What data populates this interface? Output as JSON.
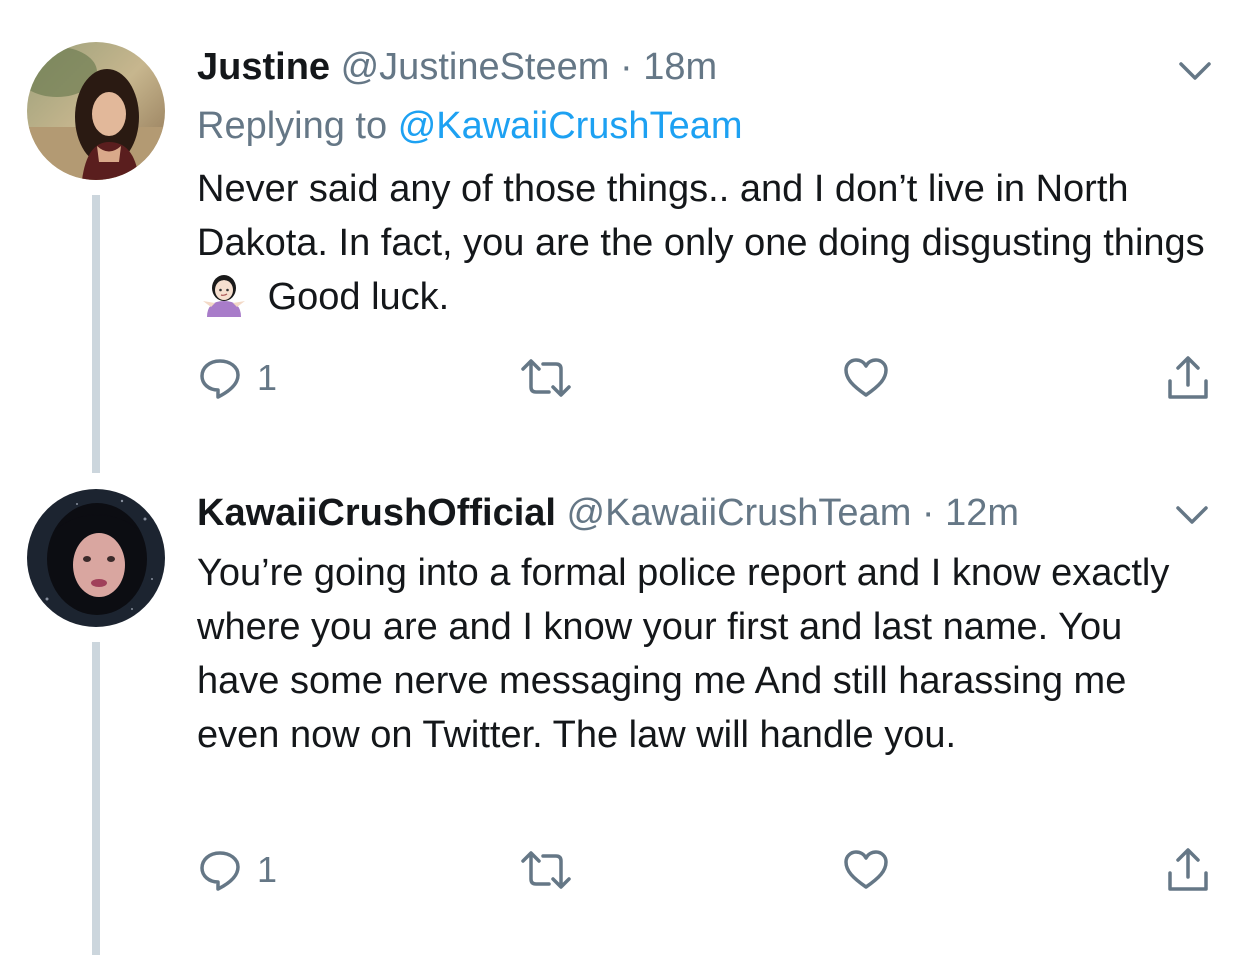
{
  "tweets": [
    {
      "display_name": "Justine",
      "handle": "@JustineSteem",
      "separator": "·",
      "time": "18m",
      "replying_prefix": "Replying to",
      "replying_mention": "@KawaiiCrushTeam",
      "text_before_emoji": "Never said any of those things.. and I don’t live in North Dakota. In fact, you are the only one doing disgusting things",
      "emoji": "person-shrugging-emoji",
      "text_after_emoji": "Good luck.",
      "reply_count": "1",
      "icons": {
        "reply": "reply-icon",
        "retweet": "retweet-icon",
        "like": "heart-icon",
        "share": "share-icon",
        "menu": "chevron-down-icon"
      }
    },
    {
      "display_name": "KawaiiCrushOfficial",
      "handle": "@KawaiiCrushTeam",
      "separator": "·",
      "time": "12m",
      "text": "You’re going into a formal police report and I know exactly where you are and I know your first and last name. You have some nerve messaging me And still harassing me even now on Twitter. The law will handle you.",
      "reply_count": "1",
      "icons": {
        "reply": "reply-icon",
        "retweet": "retweet-icon",
        "like": "heart-icon",
        "share": "share-icon",
        "menu": "chevron-down-icon"
      }
    }
  ],
  "colors": {
    "text": "#14171a",
    "secondary": "#657786",
    "link": "#1da1f2",
    "thread_line": "#ccd6dd"
  }
}
